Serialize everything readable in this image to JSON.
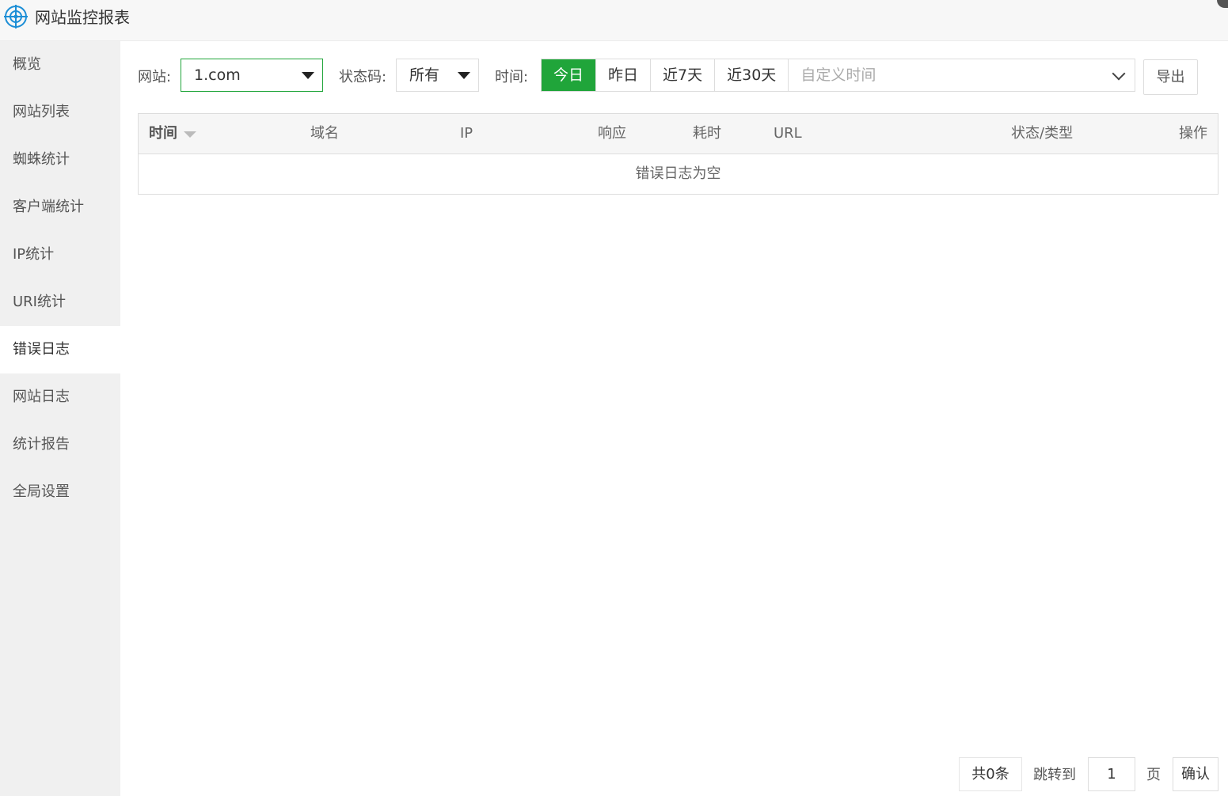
{
  "app": {
    "title": "网站监控报表",
    "icon": "crosshair-globe-icon",
    "accent_color": "#20a53a",
    "icon_color": "#1c8ed6"
  },
  "sidebar": {
    "items": [
      {
        "label": "概览"
      },
      {
        "label": "网站列表"
      },
      {
        "label": "蜘蛛统计"
      },
      {
        "label": "客户端统计"
      },
      {
        "label": "IP统计"
      },
      {
        "label": "URI统计"
      },
      {
        "label": "错误日志",
        "active": true
      },
      {
        "label": "网站日志"
      },
      {
        "label": "统计报告"
      },
      {
        "label": "全局设置"
      }
    ]
  },
  "filters": {
    "site_label": "网站:",
    "site_value": "1.com",
    "status_label": "状态码:",
    "status_value": "所有",
    "time_label": "时间:",
    "time_buttons": [
      "今日",
      "昨日",
      "近7天",
      "近30天"
    ],
    "time_active": "今日",
    "custom_time_placeholder": "自定义时间",
    "export_label": "导出"
  },
  "table": {
    "columns": [
      "时间",
      "域名",
      "IP",
      "响应",
      "耗时",
      "URL",
      "状态/类型",
      "操作"
    ],
    "empty_text": "错误日志为空"
  },
  "pagination": {
    "total": "共0条",
    "jump_label": "跳转到",
    "page_value": "1",
    "page_suffix": "页",
    "confirm_label": "确认"
  }
}
